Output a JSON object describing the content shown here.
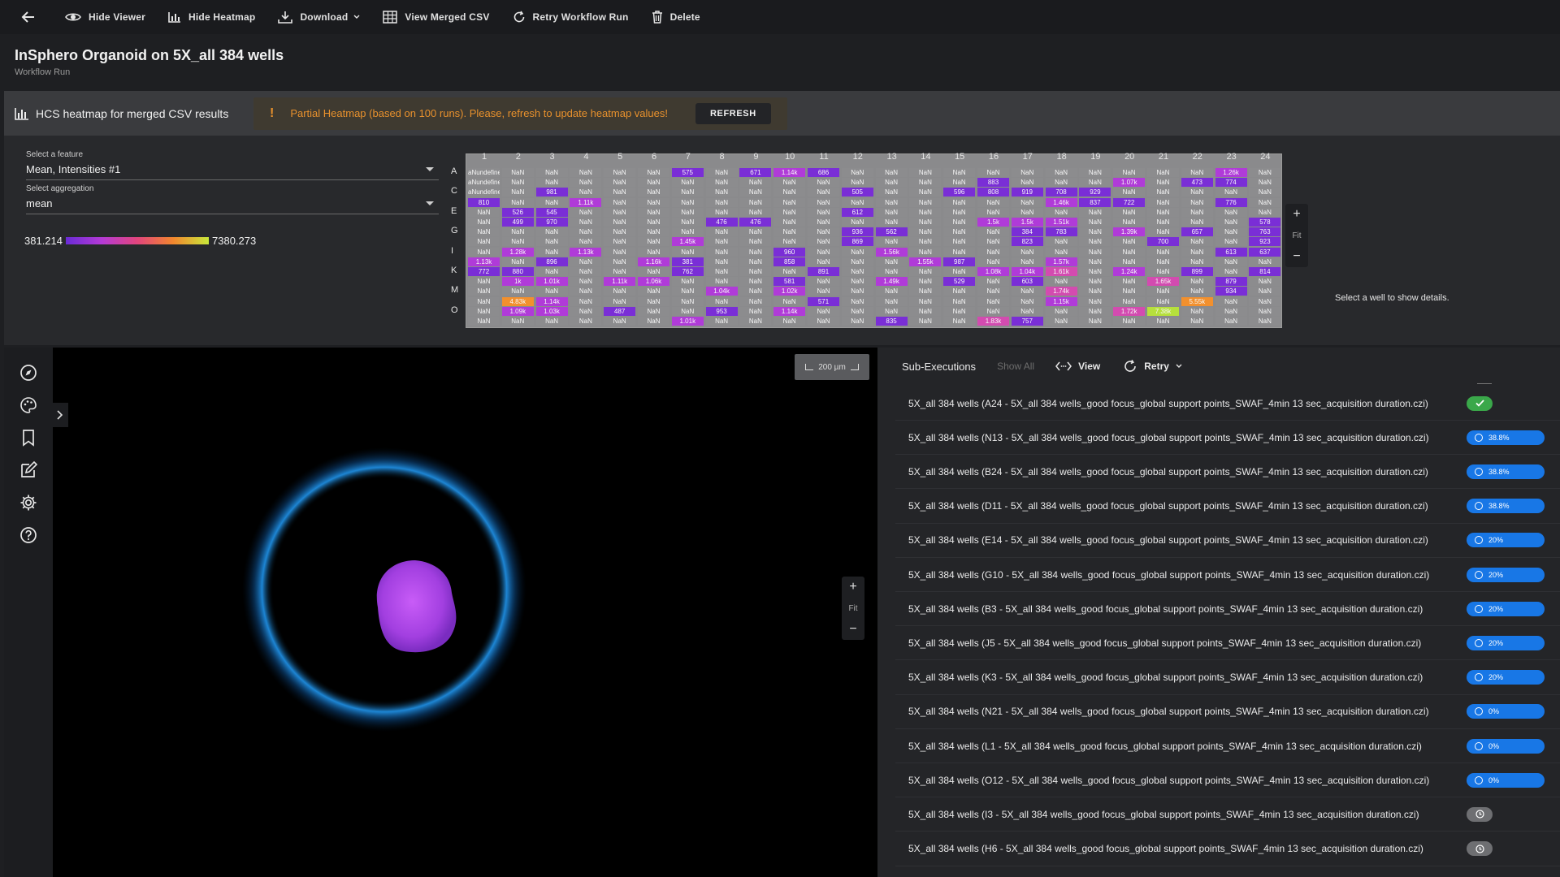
{
  "toolbar": {
    "hide_viewer": "Hide Viewer",
    "hide_heatmap": "Hide Heatmap",
    "download": "Download",
    "view_merged_csv": "View Merged CSV",
    "retry_workflow_run": "Retry Workflow Run",
    "delete": "Delete"
  },
  "header": {
    "title": "InSphero Organoid on 5X_all 384 wells",
    "subtitle": "Workflow Run"
  },
  "heatmap": {
    "title": "HCS heatmap for merged CSV results",
    "warning_text": "Partial Heatmap (based on 100 runs). Please, refresh to update heatmap values!",
    "refresh_label": "REFRESH",
    "feature_label": "Select a feature",
    "feature_value": "Mean, Intensities #1",
    "aggregation_label": "Select aggregation",
    "aggregation_value": "mean",
    "legend_min": "381.214",
    "legend_max": "7380.273",
    "select_well_message": "Select a well to show details.",
    "fit_label": "Fit",
    "columns": [
      "1",
      "2",
      "3",
      "4",
      "5",
      "6",
      "7",
      "8",
      "9",
      "10",
      "11",
      "12",
      "13",
      "14",
      "15",
      "16",
      "17",
      "18",
      "19",
      "20",
      "21",
      "22",
      "23",
      "24"
    ],
    "row_labels": [
      "A",
      "C",
      "E",
      "G",
      "I",
      "K",
      "M",
      "O"
    ],
    "colors": {
      "nan": "#8c8c8e",
      "low": "#7a2ed6",
      "mid": "#b03bd8",
      "pink": "#d34bb0",
      "orange": "#f2902e",
      "green": "#b6e03c"
    },
    "wells": [
      [
        "aNundefined",
        "NaN",
        "NaN",
        "NaN",
        "NaN",
        "NaN",
        "575",
        "NaN",
        "671",
        "1.14k",
        "686",
        "NaN",
        "NaN",
        "NaN",
        "NaN",
        "NaN",
        "NaN",
        "NaN",
        "NaN",
        "NaN",
        "NaN",
        "NaN",
        "1.26k",
        "NaN"
      ],
      [
        "aNundefined",
        "NaN",
        "NaN",
        "NaN",
        "NaN",
        "NaN",
        "NaN",
        "NaN",
        "NaN",
        "NaN",
        "NaN",
        "NaN",
        "NaN",
        "NaN",
        "NaN",
        "883",
        "NaN",
        "NaN",
        "NaN",
        "1.07k",
        "NaN",
        "473",
        "774",
        "NaN"
      ],
      [
        "aNundefined",
        "NaN",
        "981",
        "NaN",
        "NaN",
        "NaN",
        "NaN",
        "NaN",
        "NaN",
        "NaN",
        "NaN",
        "505",
        "NaN",
        "NaN",
        "596",
        "808",
        "919",
        "708",
        "929",
        "NaN",
        "NaN",
        "NaN",
        "NaN",
        "NaN"
      ],
      [
        "810",
        "NaN",
        "NaN",
        "1.11k",
        "NaN",
        "NaN",
        "NaN",
        "NaN",
        "NaN",
        "NaN",
        "NaN",
        "NaN",
        "NaN",
        "NaN",
        "NaN",
        "NaN",
        "NaN",
        "1.46k",
        "837",
        "722",
        "NaN",
        "NaN",
        "776",
        "NaN"
      ],
      [
        "NaN",
        "526",
        "545",
        "NaN",
        "NaN",
        "NaN",
        "NaN",
        "NaN",
        "NaN",
        "NaN",
        "NaN",
        "612",
        "NaN",
        "NaN",
        "NaN",
        "NaN",
        "NaN",
        "NaN",
        "NaN",
        "NaN",
        "NaN",
        "NaN",
        "NaN",
        "NaN"
      ],
      [
        "NaN",
        "499",
        "970",
        "NaN",
        "NaN",
        "NaN",
        "NaN",
        "476",
        "476",
        "NaN",
        "NaN",
        "NaN",
        "NaN",
        "NaN",
        "NaN",
        "1.5k",
        "1.5k",
        "1.51k",
        "NaN",
        "NaN",
        "NaN",
        "NaN",
        "NaN",
        "578"
      ],
      [
        "NaN",
        "NaN",
        "NaN",
        "NaN",
        "NaN",
        "NaN",
        "NaN",
        "NaN",
        "NaN",
        "NaN",
        "NaN",
        "936",
        "562",
        "NaN",
        "NaN",
        "NaN",
        "384",
        "783",
        "NaN",
        "1.39k",
        "NaN",
        "657",
        "NaN",
        "763"
      ],
      [
        "NaN",
        "NaN",
        "NaN",
        "NaN",
        "NaN",
        "NaN",
        "1.45k",
        "NaN",
        "NaN",
        "NaN",
        "NaN",
        "869",
        "NaN",
        "NaN",
        "NaN",
        "NaN",
        "823",
        "NaN",
        "NaN",
        "NaN",
        "700",
        "NaN",
        "NaN",
        "923"
      ],
      [
        "NaN",
        "1.28k",
        "NaN",
        "1.13k",
        "NaN",
        "NaN",
        "NaN",
        "NaN",
        "NaN",
        "960",
        "NaN",
        "NaN",
        "1.56k",
        "NaN",
        "NaN",
        "NaN",
        "NaN",
        "NaN",
        "NaN",
        "NaN",
        "NaN",
        "NaN",
        "613",
        "637"
      ],
      [
        "1.13k",
        "NaN",
        "896",
        "NaN",
        "NaN",
        "1.16k",
        "381",
        "NaN",
        "NaN",
        "858",
        "NaN",
        "NaN",
        "NaN",
        "1.55k",
        "987",
        "NaN",
        "NaN",
        "1.57k",
        "NaN",
        "NaN",
        "NaN",
        "NaN",
        "NaN",
        "NaN"
      ],
      [
        "772",
        "880",
        "NaN",
        "NaN",
        "NaN",
        "NaN",
        "762",
        "NaN",
        "NaN",
        "NaN",
        "891",
        "NaN",
        "NaN",
        "NaN",
        "NaN",
        "1.08k",
        "1.04k",
        "1.61k",
        "NaN",
        "1.24k",
        "NaN",
        "899",
        "NaN",
        "814"
      ],
      [
        "NaN",
        "1k",
        "1.01k",
        "NaN",
        "1.11k",
        "1.06k",
        "NaN",
        "NaN",
        "NaN",
        "581",
        "NaN",
        "NaN",
        "1.49k",
        "NaN",
        "529",
        "NaN",
        "603",
        "NaN",
        "NaN",
        "NaN",
        "1.65k",
        "NaN",
        "879",
        "NaN"
      ],
      [
        "NaN",
        "NaN",
        "NaN",
        "NaN",
        "NaN",
        "NaN",
        "NaN",
        "1.04k",
        "NaN",
        "1.02k",
        "NaN",
        "NaN",
        "NaN",
        "NaN",
        "NaN",
        "NaN",
        "NaN",
        "1.74k",
        "NaN",
        "NaN",
        "NaN",
        "NaN",
        "934",
        "NaN"
      ],
      [
        "NaN",
        "4.83k",
        "1.14k",
        "NaN",
        "NaN",
        "NaN",
        "NaN",
        "NaN",
        "NaN",
        "NaN",
        "571",
        "NaN",
        "NaN",
        "NaN",
        "NaN",
        "NaN",
        "NaN",
        "1.15k",
        "NaN",
        "NaN",
        "NaN",
        "5.55k",
        "NaN",
        "NaN"
      ],
      [
        "NaN",
        "1.09k",
        "1.03k",
        "NaN",
        "487",
        "NaN",
        "NaN",
        "953",
        "NaN",
        "1.14k",
        "NaN",
        "NaN",
        "NaN",
        "NaN",
        "NaN",
        "NaN",
        "NaN",
        "NaN",
        "NaN",
        "1.72k",
        "7.38k",
        "NaN",
        "NaN",
        "NaN"
      ],
      [
        "NaN",
        "NaN",
        "NaN",
        "NaN",
        "NaN",
        "NaN",
        "1.01k",
        "NaN",
        "NaN",
        "NaN",
        "NaN",
        "NaN",
        "835",
        "NaN",
        "NaN",
        "1.83k",
        "757",
        "NaN",
        "NaN",
        "NaN",
        "NaN",
        "NaN",
        "NaN",
        "NaN"
      ]
    ]
  },
  "viewer": {
    "scale_label": "200 µm",
    "fit_label": "Fit"
  },
  "subexec": {
    "title": "Sub-Executions",
    "show_all": "Show All",
    "view": "View",
    "retry": "Retry",
    "rows": [
      {
        "name": "5X_all 384 wells (A24 - 5X_all 384 wells_good focus_global support points_SWAF_4min 13 sec_acquisition duration.czi)",
        "status": "done",
        "progress": ""
      },
      {
        "name": "5X_all 384 wells (N13 - 5X_all 384 wells_good focus_global support points_SWAF_4min 13 sec_acquisition duration.czi)",
        "status": "running",
        "progress": "38.8%"
      },
      {
        "name": "5X_all 384 wells (B24 - 5X_all 384 wells_good focus_global support points_SWAF_4min 13 sec_acquisition duration.czi)",
        "status": "running",
        "progress": "38.8%"
      },
      {
        "name": "5X_all 384 wells (D11 - 5X_all 384 wells_good focus_global support points_SWAF_4min 13 sec_acquisition duration.czi)",
        "status": "running",
        "progress": "38.8%"
      },
      {
        "name": "5X_all 384 wells (E14 - 5X_all 384 wells_good focus_global support points_SWAF_4min 13 sec_acquisition duration.czi)",
        "status": "running",
        "progress": "20%"
      },
      {
        "name": "5X_all 384 wells (G10 - 5X_all 384 wells_good focus_global support points_SWAF_4min 13 sec_acquisition duration.czi)",
        "status": "running",
        "progress": "20%"
      },
      {
        "name": "5X_all 384 wells (B3 - 5X_all 384 wells_good focus_global support points_SWAF_4min 13 sec_acquisition duration.czi)",
        "status": "running",
        "progress": "20%"
      },
      {
        "name": "5X_all 384 wells (J5 - 5X_all 384 wells_good focus_global support points_SWAF_4min 13 sec_acquisition duration.czi)",
        "status": "running",
        "progress": "20%"
      },
      {
        "name": "5X_all 384 wells (K3 - 5X_all 384 wells_good focus_global support points_SWAF_4min 13 sec_acquisition duration.czi)",
        "status": "running",
        "progress": "20%"
      },
      {
        "name": "5X_all 384 wells (N21 - 5X_all 384 wells_good focus_global support points_SWAF_4min 13 sec_acquisition duration.czi)",
        "status": "running",
        "progress": "0%"
      },
      {
        "name": "5X_all 384 wells (L1 - 5X_all 384 wells_good focus_global support points_SWAF_4min 13 sec_acquisition duration.czi)",
        "status": "running",
        "progress": "0%"
      },
      {
        "name": "5X_all 384 wells (O12 - 5X_all 384 wells_good focus_global support points_SWAF_4min 13 sec_acquisition duration.czi)",
        "status": "running",
        "progress": "0%"
      },
      {
        "name": "5X_all 384 wells (I3 - 5X_all 384 wells_good focus_global support points_SWAF_4min 13 sec_acquisition duration.czi)",
        "status": "waiting",
        "progress": ""
      },
      {
        "name": "5X_all 384 wells (H6 - 5X_all 384 wells_good focus_global support points_SWAF_4min 13 sec_acquisition duration.czi)",
        "status": "waiting",
        "progress": ""
      }
    ]
  }
}
